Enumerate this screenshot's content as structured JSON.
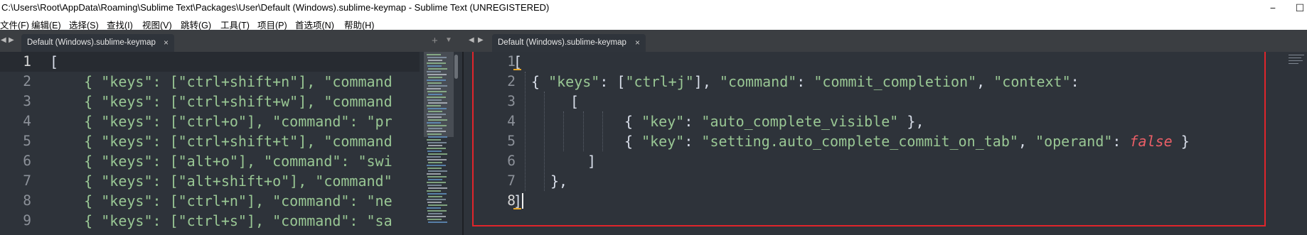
{
  "window": {
    "title": "C:\\Users\\Root\\AppData\\Roaming\\Sublime Text\\Packages\\User\\Default (Windows).sublime-keymap - Sublime Text (UNREGISTERED)",
    "minimize_glyph": "−",
    "maximize_glyph": "☐"
  },
  "menu": [
    "文件(F)",
    "编辑(E)",
    "选择(S)",
    "查找(I)",
    "视图(V)",
    "跳转(G)",
    "工具(T)",
    "项目(P)",
    "首选项(N)",
    "帮助(H)"
  ],
  "left_pane": {
    "tab": {
      "label": "Default (Windows).sublime-keymap",
      "close": "×"
    },
    "nav_prev": "◀",
    "nav_next": "▶",
    "add_glyph": "+",
    "dropdown_glyph": "▼",
    "line_numbers": [
      "1",
      "2",
      "3",
      "4",
      "5",
      "6",
      "7",
      "8",
      "9"
    ],
    "lines": [
      "[",
      "    { \"keys\": [\"ctrl+shift+n\"], \"command",
      "    { \"keys\": [\"ctrl+shift+w\"], \"command",
      "    { \"keys\": [\"ctrl+o\"], \"command\": \"pr",
      "    { \"keys\": [\"ctrl+shift+t\"], \"command",
      "    { \"keys\": [\"alt+o\"], \"command\": \"swi",
      "    { \"keys\": [\"alt+shift+o\"], \"command\"",
      "    { \"keys\": [\"ctrl+n\"], \"command\": \"ne",
      "    { \"keys\": [\"ctrl+s\"], \"command\": \"sa"
    ]
  },
  "right_pane": {
    "tab": {
      "label": "Default (Windows).sublime-keymap",
      "close": "×"
    },
    "nav_prev": "◀",
    "nav_next": "▶",
    "line_numbers": [
      "1",
      "2",
      "3",
      "4",
      "5",
      "6",
      "7",
      "8"
    ],
    "current_line": "8",
    "code": {
      "l1": "[",
      "l2_open": "{ ",
      "l2_keys": "\"keys\"",
      "l2_p1": ": [",
      "l2_ctrlj": "\"ctrl+j\"",
      "l2_p2": "], ",
      "l2_command": "\"command\"",
      "l2_p3": ": ",
      "l2_commit": "\"commit_completion\"",
      "l2_p4": ", ",
      "l2_context": "\"context\"",
      "l2_p5": ":",
      "l3": "[",
      "l4_open": "{ ",
      "l4_key": "\"key\"",
      "l4_p1": ": ",
      "l4_val": "\"auto_complete_visible\"",
      "l4_close": " },",
      "l5_open": "{ ",
      "l5_key": "\"key\"",
      "l5_p1": ": ",
      "l5_val": "\"setting.auto_complete_commit_on_tab\"",
      "l5_p2": ", ",
      "l5_operand": "\"operand\"",
      "l5_p3": ": ",
      "l5_false": "false",
      "l5_close": " }",
      "l6": "]",
      "l7": "},",
      "l8": "]"
    }
  },
  "colors": {
    "string": "#99c794",
    "boolean": "#ec5f67",
    "highlight_box": "#e0252b",
    "bracket_match": "#e7a62a"
  }
}
